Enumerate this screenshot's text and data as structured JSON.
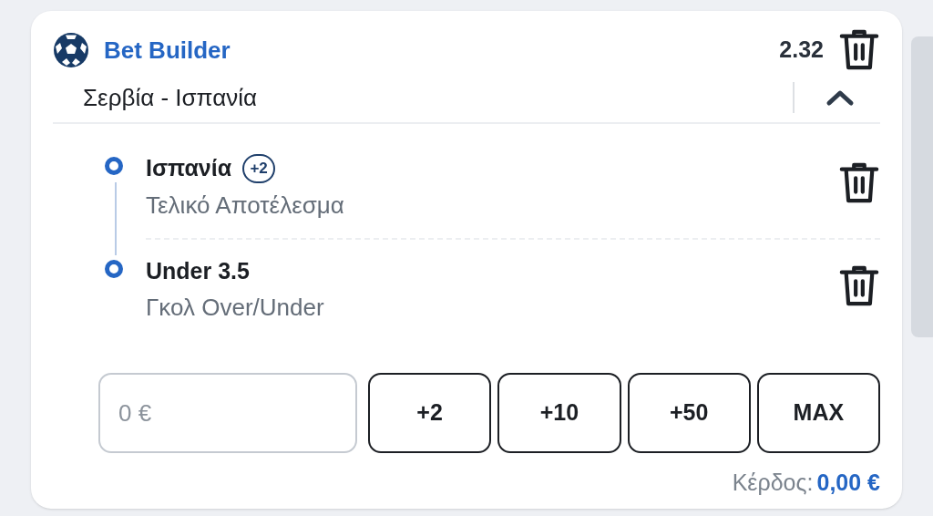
{
  "header": {
    "title": "Bet Builder",
    "odds": "2.32"
  },
  "match": {
    "name": "Σερβία - Ισπανία",
    "expanded": true
  },
  "selections": [
    {
      "name": "Ισπανία",
      "badge": "+2",
      "market": "Τελικό Αποτέλεσμα"
    },
    {
      "name": "Under 3.5",
      "market": "Γκολ Over/Under"
    }
  ],
  "stake": {
    "placeholder": "0 €"
  },
  "quick_buttons": [
    "+2",
    "+10",
    "+50",
    "MAX"
  ],
  "profit": {
    "label": "Κέρδος:",
    "value": "0,00 €"
  }
}
